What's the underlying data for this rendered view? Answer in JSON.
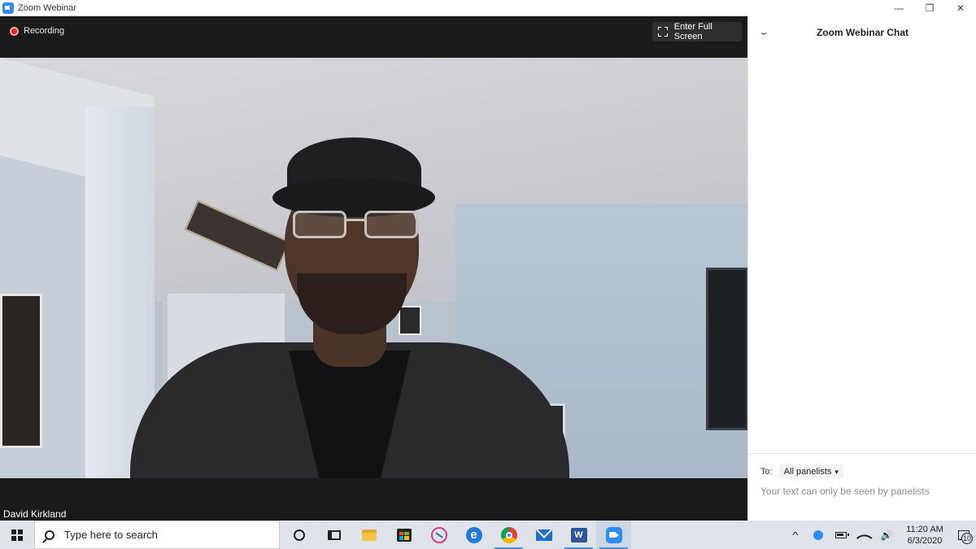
{
  "window": {
    "title": "Zoom Webinar",
    "controls": {
      "minimize": "—",
      "restore": "❐",
      "close": "✕"
    }
  },
  "meeting": {
    "recording_label": "Recording",
    "fullscreen_label": "Enter Full Screen",
    "participant_name": "David Kirkland"
  },
  "chat": {
    "title": "Zoom Webinar Chat",
    "collapse_glyph": "⌄",
    "to_label": "To:",
    "recipient": "All panelists",
    "recipient_arrow": "▾",
    "input_placeholder": "Your text can only be seen by panelists"
  },
  "taskbar": {
    "search_placeholder": "Type here to search",
    "apps": [
      "cortana-icon",
      "task-view-icon",
      "file-explorer-icon",
      "store-icon",
      "snip-sketch-icon",
      "edge-icon",
      "chrome-icon",
      "mail-icon",
      "word-icon",
      "zoom-icon"
    ],
    "word_letter": "W",
    "edge_letter": "e",
    "tray": {
      "caret": "^",
      "volume": "🔊",
      "time": "11:20 AM",
      "date": "6/3/2020",
      "notification_count": "10"
    }
  },
  "colors": {
    "zoom_blue": "#2d8cff",
    "recording_red": "#e02828",
    "meeting_bg": "#1a1a1a"
  }
}
